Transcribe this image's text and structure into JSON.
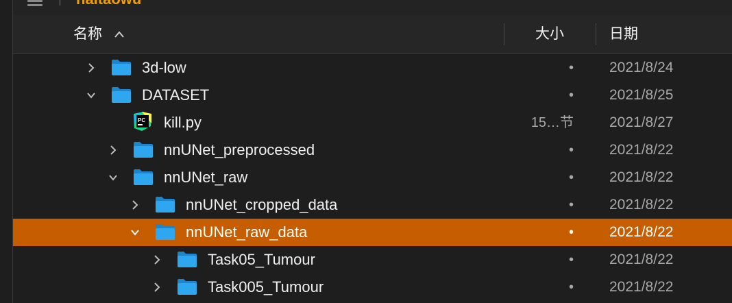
{
  "toolbar": {
    "folder_name": "haitaowu"
  },
  "header": {
    "name_label": "名称",
    "size_label": "大小",
    "date_label": "日期"
  },
  "rows": [
    {
      "name": "3d-low",
      "size": "•",
      "date": "2021/8/24",
      "kind": "folder",
      "expanded": false,
      "depth": 0
    },
    {
      "name": "DATASET",
      "size": "•",
      "date": "2021/8/25",
      "kind": "folder",
      "expanded": true,
      "depth": 0
    },
    {
      "name": "kill.py",
      "size": "15…节",
      "date": "2021/8/27",
      "kind": "python",
      "expanded": null,
      "depth": 1
    },
    {
      "name": "nnUNet_preprocessed",
      "size": "•",
      "date": "2021/8/22",
      "kind": "folder",
      "expanded": false,
      "depth": 1
    },
    {
      "name": "nnUNet_raw",
      "size": "•",
      "date": "2021/8/22",
      "kind": "folder",
      "expanded": true,
      "depth": 1
    },
    {
      "name": "nnUNet_cropped_data",
      "size": "•",
      "date": "2021/8/22",
      "kind": "folder",
      "expanded": false,
      "depth": 2
    },
    {
      "name": "nnUNet_raw_data",
      "size": "•",
      "date": "2021/8/22",
      "kind": "folder",
      "expanded": true,
      "depth": 2,
      "selected": true
    },
    {
      "name": "Task05_Tumour",
      "size": "•",
      "date": "2021/8/22",
      "kind": "folder",
      "expanded": false,
      "depth": 3
    },
    {
      "name": "Task005_Tumour",
      "size": "•",
      "date": "2021/8/22",
      "kind": "folder",
      "expanded": false,
      "depth": 3
    }
  ],
  "colors": {
    "selection": "#c65d00",
    "folder": "#2ea7f0",
    "accent_title": "#f0a000"
  },
  "icons": {
    "folder": "folder-icon",
    "python": "pycharm-file-icon",
    "expand": "chevron-down-icon",
    "collapse": "chevron-right-icon",
    "sort": "sort-ascending-icon",
    "view": "list-view-icon"
  }
}
